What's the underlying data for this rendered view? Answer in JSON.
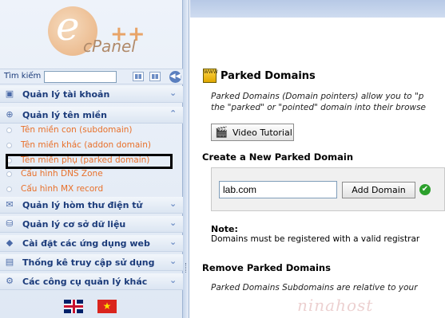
{
  "logo": {
    "text": "cPanel",
    "plus": "++"
  },
  "search": {
    "label": "Tìm kiếm",
    "value": ""
  },
  "sidebar": {
    "menu_top": [
      {
        "label": "Quản lý tài khoản",
        "icon": "accounts-icon"
      },
      {
        "label": "Quản lý tên miền",
        "icon": "domains-icon"
      }
    ],
    "sub_items": [
      {
        "label": "Tên miền con (subdomain)"
      },
      {
        "label": "Tên miền khác (addon domain)"
      },
      {
        "label": "Tên miền phụ (parked domain)"
      },
      {
        "label": "Cấu hình DNS Zone"
      },
      {
        "label": "Cấu hình MX record"
      }
    ],
    "menu_bottom": [
      {
        "label": "Quản lý hòm thư điện tử",
        "icon": "mail-icon"
      },
      {
        "label": "Quản lý cơ sở dữ liệu",
        "icon": "database-icon"
      },
      {
        "label": "Cài đặt các ứng dụng web",
        "icon": "apps-icon"
      },
      {
        "label": "Thống kê truy cập sử dụng",
        "icon": "stats-icon"
      },
      {
        "label": "Các công cụ quản lý khác",
        "icon": "tools-icon"
      }
    ]
  },
  "main": {
    "title": "Parked Domains",
    "intro_line1": "Parked Domains (Domain pointers) allow you to \"p",
    "intro_line2": "the \"parked\" or \"pointed\" domain into their browse",
    "video_label": "Video Tutorial",
    "create_heading": "Create a New Parked Domain",
    "domain_value": "lab.com",
    "add_label": "Add Domain",
    "note_title": "Note:",
    "note_text": "Domains must be registered with a valid registrar",
    "remove_heading": "Remove Parked Domains",
    "remove_text": "Parked Domains Subdomains are relative to your",
    "watermark": "ninahost"
  },
  "colors": {
    "accent": "#1b3b7a",
    "link": "#e8702a",
    "ok": "#2ca02c"
  }
}
